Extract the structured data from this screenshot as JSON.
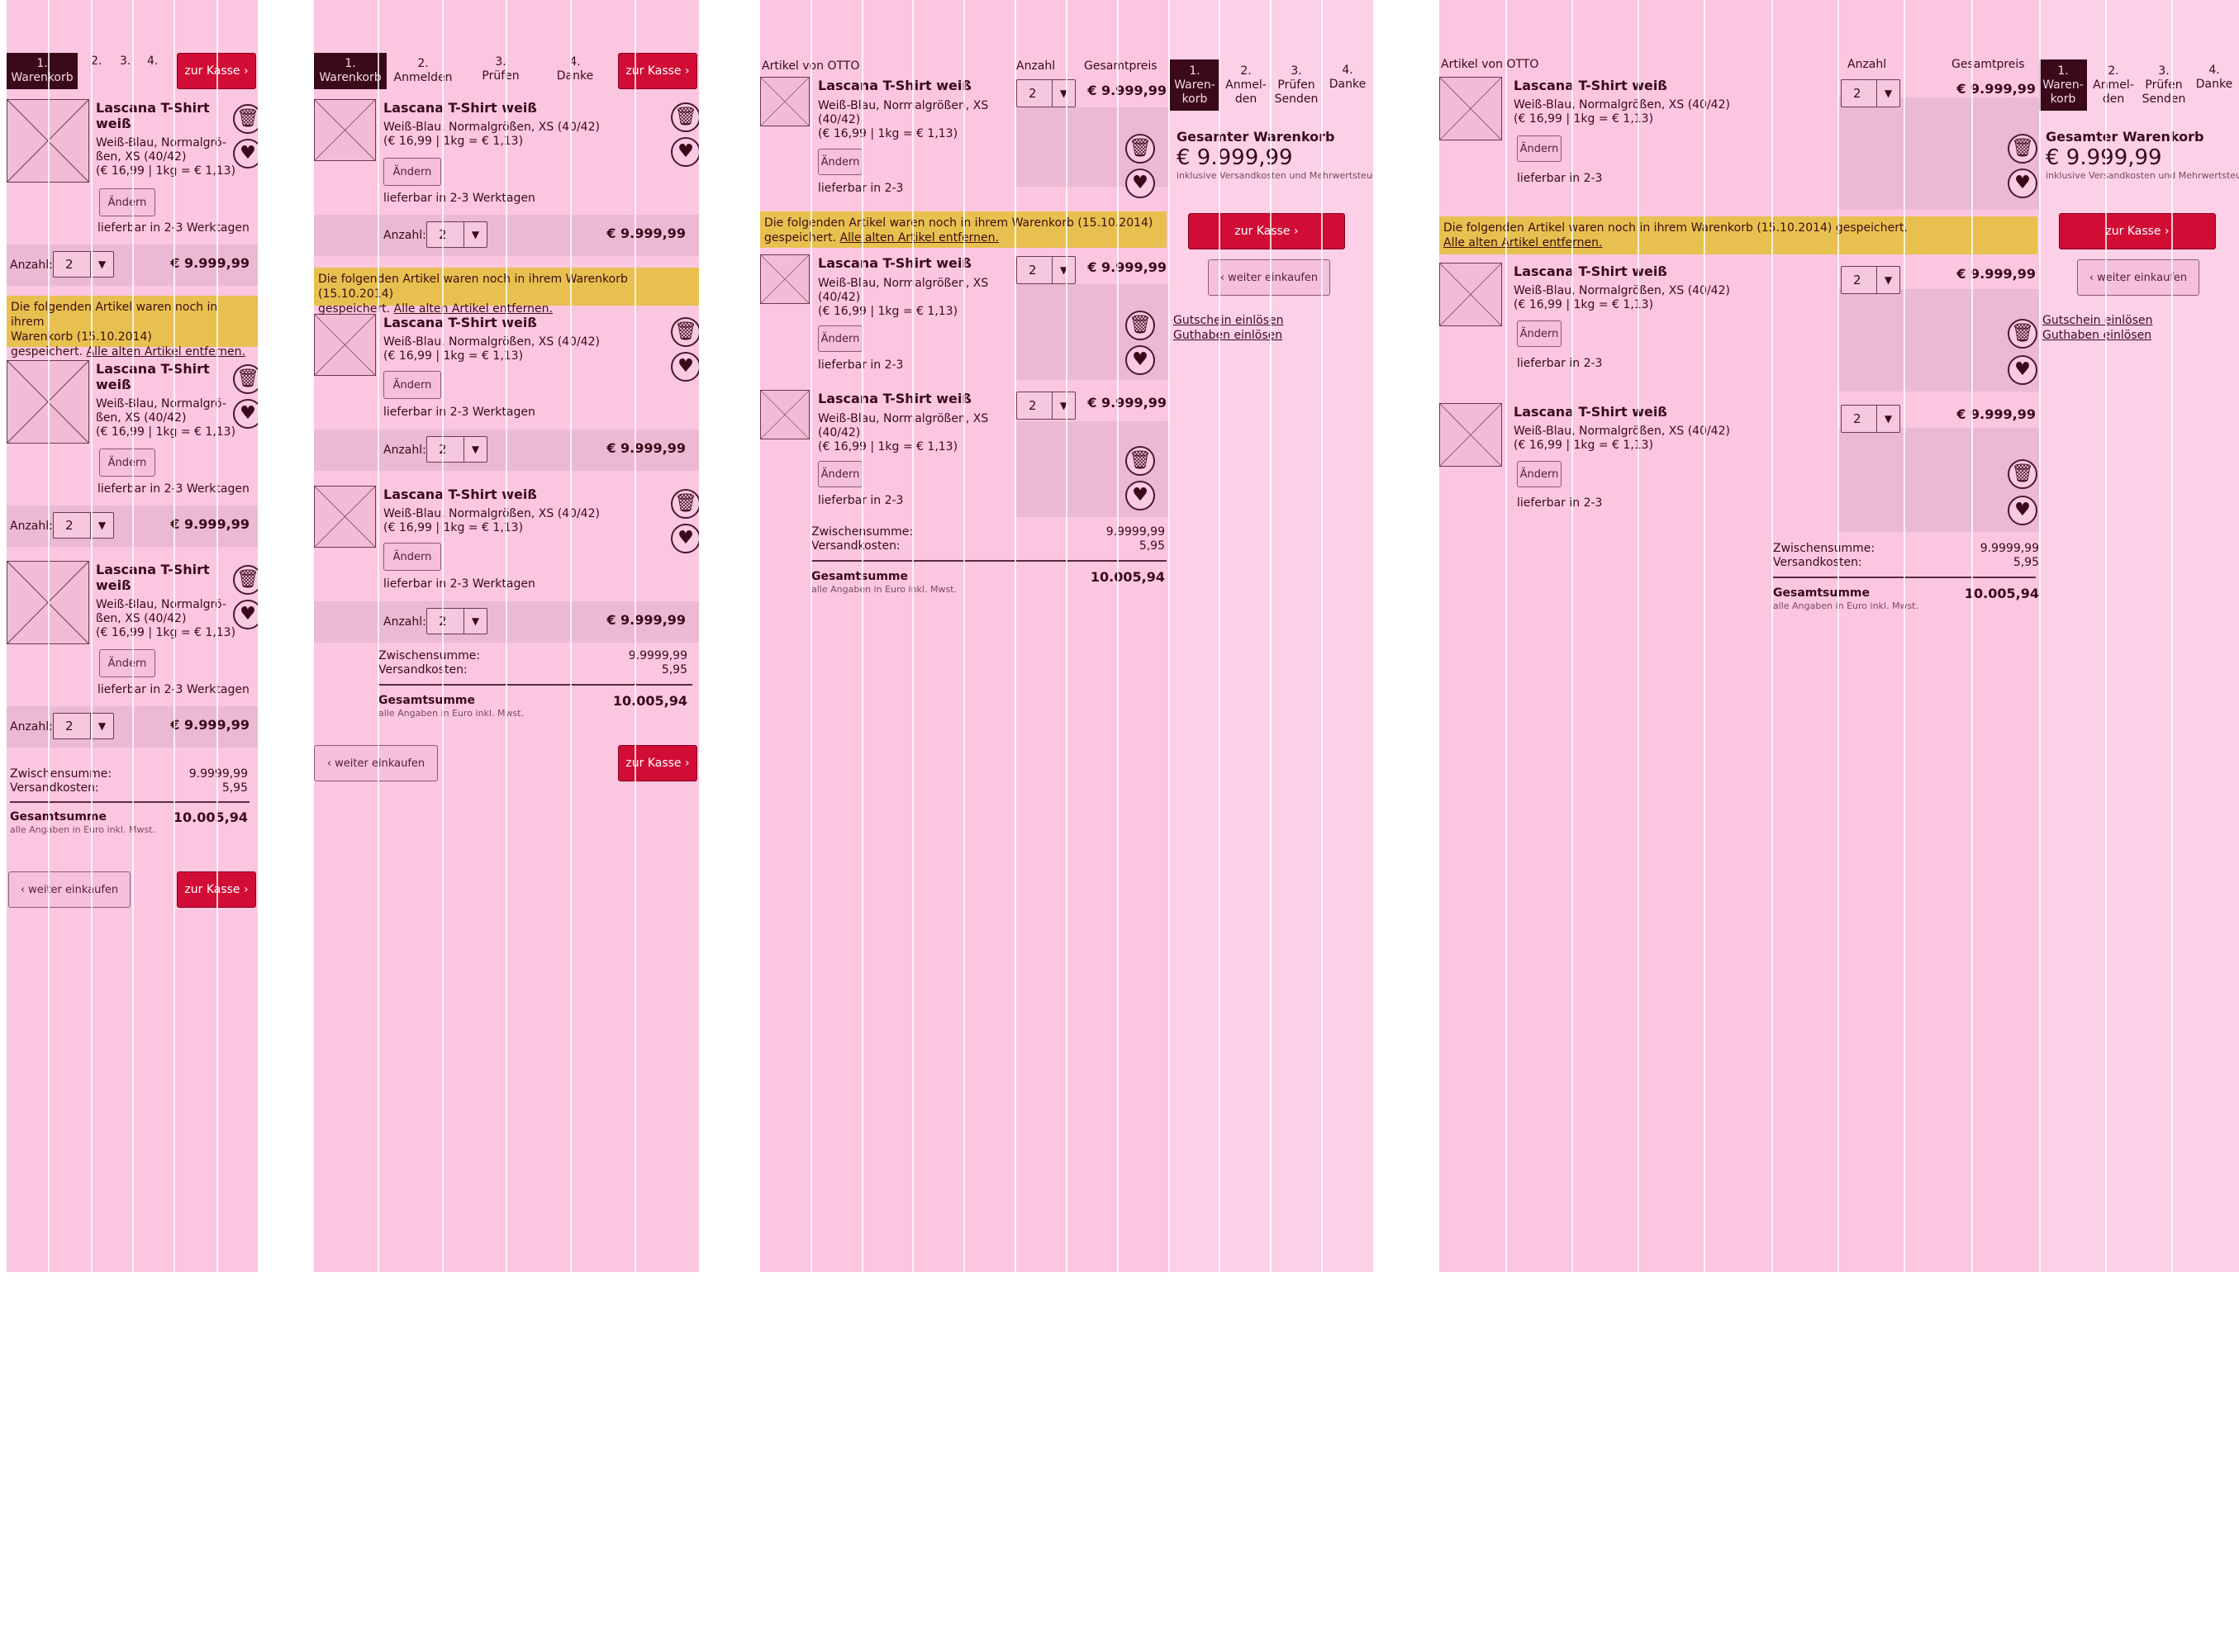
{
  "checkout": {
    "steps": {
      "n1": "1.",
      "n2": "2.",
      "n3": "3.",
      "n4": "4.",
      "warenkorb": "Warenkorb",
      "anmelden": "Anmelden",
      "pruefen": "Prüfen",
      "danke": "Danke",
      "waren": "Waren-",
      "korb": "korb",
      "anmel": "Anmel-",
      "den": "den",
      "senden": "Senden"
    },
    "buttons": {
      "zur_kasse": "zur Kasse ›",
      "weiter_einkaufen": "‹ weiter einkaufen",
      "aendern": "Ändern"
    },
    "product": {
      "title_line1": "Lascana T-Shirt",
      "title_line2": "weiß",
      "title_full": "Lascana T-Shirt weiß",
      "variant": "Weiß-Blau, Normalgrößen, XS (40/42)",
      "variant_a1": "Weiß-Blau, Normalgrö-",
      "variant_a2": "ßen, XS (40/42)",
      "variant_b1": "Weiß-Blau, Normalgrößen, XS",
      "variant_b2": "(40/42)",
      "unit_price": "(€ 16,99 | 1kg = € 1,13)",
      "delivery": "lieferbar in 2-3 Werktagen",
      "delivery_short": "lieferbar in 2-3",
      "price": "€ 9.999,99"
    },
    "quantity": {
      "label": "Anzahl:",
      "value": "2"
    },
    "notice": {
      "text": "Die folgenden Artikel waren noch in ihrem Warenkorb (15.10.2014) gespeichert.",
      "a1": "Die folgenden Artikel waren noch in ihrem",
      "a2": "Warenkorb (15.10.2014)",
      "a3": "gespeichert.",
      "b1": "Die folgenden Artikel waren noch in ihrem Warenkorb (15.10.2014)",
      "b2": "gespeichert.",
      "link": "Alle alten Artikel entfernen."
    },
    "totals": {
      "subtotal_label": "Zwischensumme:",
      "subtotal_value": "9.9999,99",
      "subtotal_value_alt": "9.9999,99",
      "shipping_label": "Versandkosten:",
      "shipping_value": "5,95",
      "total_label": "Gesamtsumme",
      "total_value": "10.005,94",
      "vat_note": "alle Angaben in Euro inkl. Mwst."
    },
    "table_header": {
      "artikel": "Artikel von OTTO",
      "anzahl": "Anzahl",
      "gesamtpreis": "Gesamtpreis"
    },
    "summary": {
      "title": "Gesamter Warenkorb",
      "price": "€ 9.999,99",
      "note": "inklusive Versandkosten und Mehrwertsteuer",
      "voucher": "Gutschein einlösen",
      "credit": "Guthaben einlösen"
    },
    "icons": {
      "trash": "trash-icon",
      "heart": "heart-icon",
      "dropdown": "chevron-down-icon"
    },
    "colors": {
      "bg": "#fbc6e0",
      "active_step": "#3a0a1a",
      "cta": "#d10d35",
      "notice": "#e8c050"
    }
  }
}
